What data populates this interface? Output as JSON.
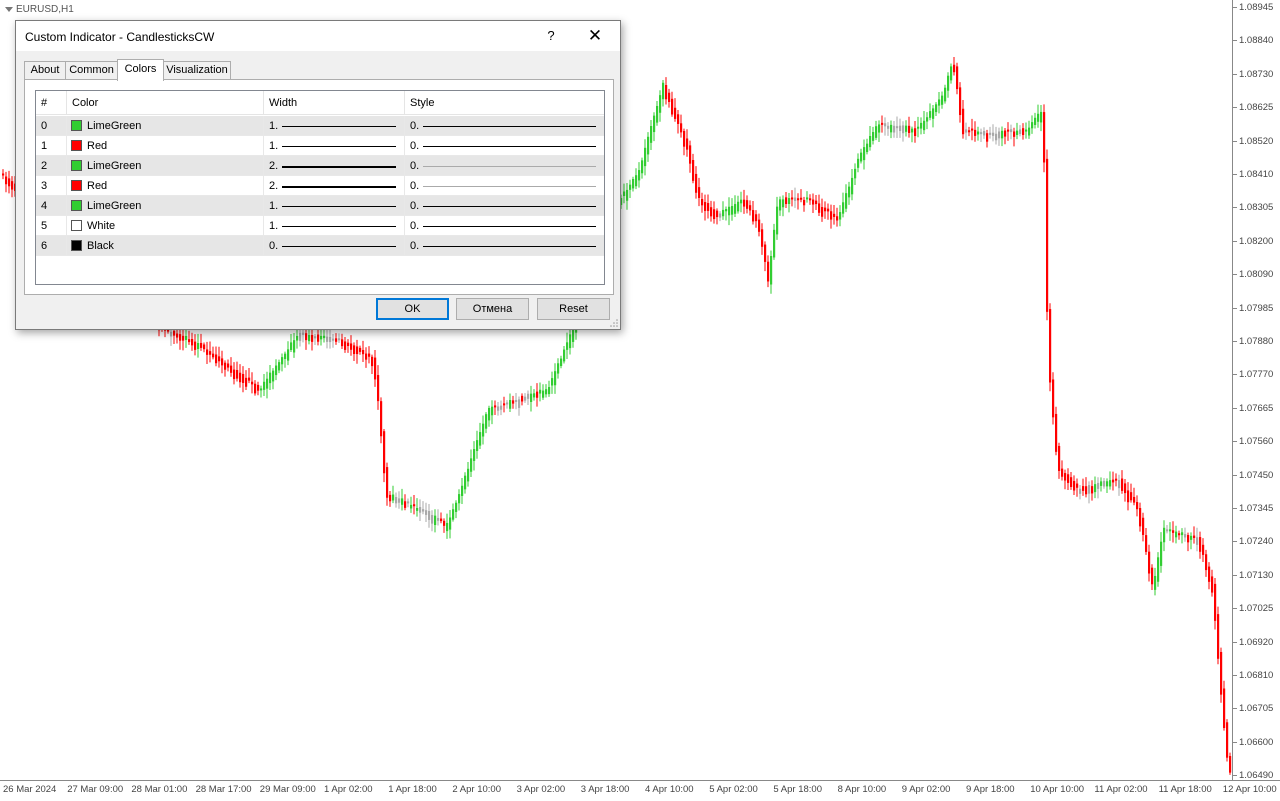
{
  "chart": {
    "symbol": "EURUSD,H1",
    "bull_color": "#32cd32",
    "bear_color": "#ff0000",
    "neutral_color": "#a9a9a9",
    "price_ticks": [
      "1.08945",
      "1.08840",
      "1.08730",
      "1.08625",
      "1.08520",
      "1.08410",
      "1.08305",
      "1.08200",
      "1.08090",
      "1.07985",
      "1.07880",
      "1.07770",
      "1.07665",
      "1.07560",
      "1.07450",
      "1.07345",
      "1.07240",
      "1.07130",
      "1.07025",
      "1.06920",
      "1.06810",
      "1.06705",
      "1.06600",
      "1.06490"
    ],
    "time_ticks": [
      "26 Mar 2024",
      "27 Mar 09:00",
      "28 Mar 01:00",
      "28 Mar 17:00",
      "29 Mar 09:00",
      "1 Apr 02:00",
      "1 Apr 18:00",
      "2 Apr 10:00",
      "3 Apr 02:00",
      "3 Apr 18:00",
      "4 Apr 10:00",
      "5 Apr 02:00",
      "5 Apr 18:00",
      "8 Apr 10:00",
      "9 Apr 02:00",
      "9 Apr 18:00",
      "10 Apr 10:00",
      "11 Apr 02:00",
      "11 Apr 18:00",
      "12 Apr 10:00"
    ]
  },
  "dialog": {
    "title": "Custom Indicator - CandlesticksCW",
    "help_label": "?",
    "close_label": "✕",
    "tabs": [
      {
        "label": "About"
      },
      {
        "label": "Common"
      },
      {
        "label": "Colors"
      },
      {
        "label": "Visualization"
      }
    ],
    "columns": {
      "index": "#",
      "color": "Color",
      "width": "Width",
      "style": "Style"
    },
    "rows": [
      {
        "index": "0",
        "color_name": "LimeGreen",
        "color_hex": "#32cd32",
        "width_label": "1.",
        "line_width": 1,
        "style_label": "0."
      },
      {
        "index": "1",
        "color_name": "Red",
        "color_hex": "#ff0000",
        "width_label": "1.",
        "line_width": 1,
        "style_label": "0."
      },
      {
        "index": "2",
        "color_name": "LimeGreen",
        "color_hex": "#32cd32",
        "width_label": "2.",
        "line_width": 2,
        "style_label": "0."
      },
      {
        "index": "3",
        "color_name": "Red",
        "color_hex": "#ff0000",
        "width_label": "2.",
        "line_width": 2,
        "style_label": "0."
      },
      {
        "index": "4",
        "color_name": "LimeGreen",
        "color_hex": "#32cd32",
        "width_label": "1.",
        "line_width": 1,
        "style_label": "0."
      },
      {
        "index": "5",
        "color_name": "White",
        "color_hex": "#ffffff",
        "width_label": "1.",
        "line_width": 1,
        "style_label": "0."
      },
      {
        "index": "6",
        "color_name": "Black",
        "color_hex": "#000000",
        "width_label": "0.",
        "line_width": 1,
        "style_label": "0."
      }
    ],
    "buttons": {
      "ok": "OK",
      "cancel": "Отмена",
      "reset": "Reset"
    }
  }
}
